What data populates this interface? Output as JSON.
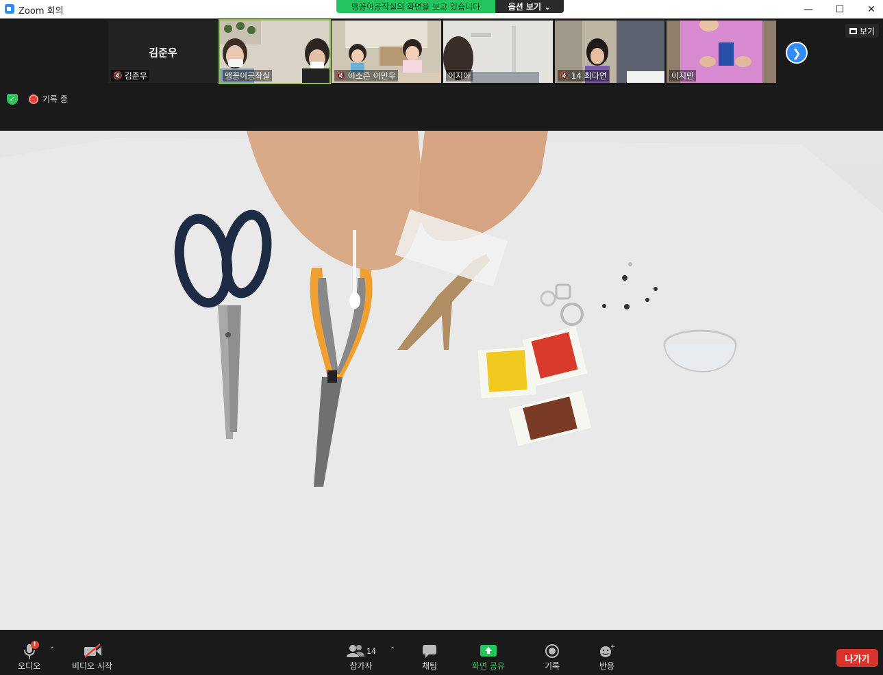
{
  "window": {
    "title": "Zoom 회의"
  },
  "share_banner": {
    "text": "맹꽁이공작실의 화면을 보고 있습니다",
    "options_label": "옵션 보기 ⌄"
  },
  "view_button": {
    "label": "보기"
  },
  "participants_strip": [
    {
      "name": "김준우",
      "big_name": "김준우",
      "muted": true
    },
    {
      "name": "맹꽁이공작실",
      "muted": false,
      "active": true
    },
    {
      "name": "이소은 이민우",
      "muted": true
    },
    {
      "name": "이지아",
      "muted": false
    },
    {
      "name": "14 최다연",
      "muted": true
    },
    {
      "name": "이지민",
      "muted": false
    }
  ],
  "recording": {
    "label": "기록 중"
  },
  "toolbar": {
    "audio": "오디오",
    "video": "비디오 시작",
    "participants": "참가자",
    "participants_count": "14",
    "chat": "채팅",
    "share": "화면 공유",
    "record": "기록",
    "reactions": "반응",
    "leave": "나가기"
  },
  "colors": {
    "accent": "#2d8cff",
    "share_green": "#23c55e",
    "leave_red": "#d9342b"
  }
}
